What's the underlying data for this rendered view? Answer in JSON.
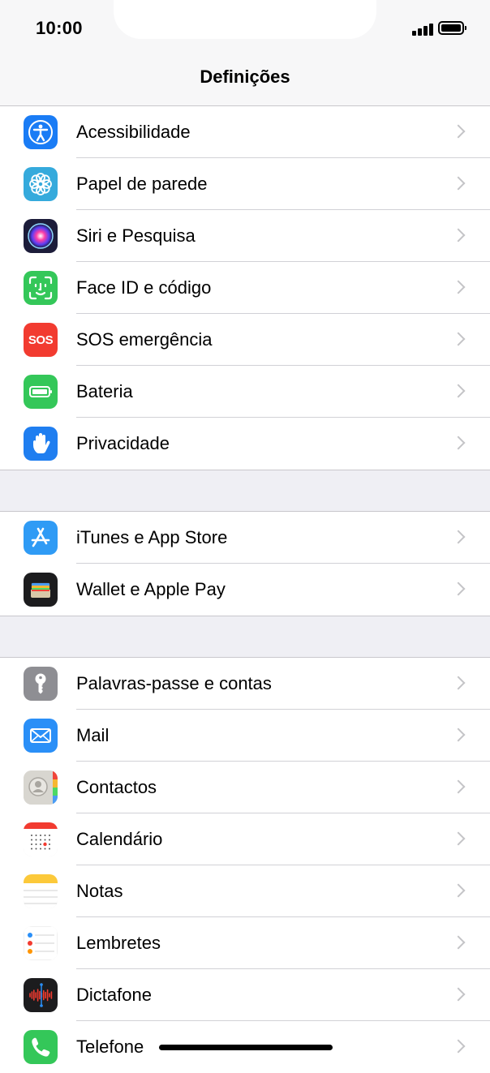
{
  "status": {
    "time": "10:00"
  },
  "nav": {
    "title": "Definições"
  },
  "groups": [
    [
      {
        "label": "Acessibilidade",
        "icon": "accessibility-icon",
        "color": "#1a7cf5"
      },
      {
        "label": "Papel de parede",
        "icon": "wallpaper-icon",
        "color": "#35aadc"
      },
      {
        "label": "Siri e Pesquisa",
        "icon": "siri-icon",
        "color": "#1c1c3a"
      },
      {
        "label": "Face ID e código",
        "icon": "face-id-icon",
        "color": "#34c759"
      },
      {
        "label": "SOS emergência",
        "icon": "sos-icon",
        "color": "#f23b30",
        "icon_text": "SOS"
      },
      {
        "label": "Bateria",
        "icon": "battery-icon",
        "color": "#34c759"
      },
      {
        "label": "Privacidade",
        "icon": "hand-icon",
        "color": "#1f7ef0"
      }
    ],
    [
      {
        "label": "iTunes e App Store",
        "icon": "app-store-icon",
        "color": "#2f9bf5"
      },
      {
        "label": "Wallet e Apple Pay",
        "icon": "wallet-icon",
        "color": "#1c1c1e"
      }
    ],
    [
      {
        "label": "Palavras-passe e contas",
        "icon": "key-icon",
        "color": "#8e8e93"
      },
      {
        "label": "Mail",
        "icon": "mail-icon",
        "color": "#2a8ff7"
      },
      {
        "label": "Contactos",
        "icon": "contacts-icon",
        "color": "#d8d6d0"
      },
      {
        "label": "Calendário",
        "icon": "calendar-icon",
        "color": "#ffffff"
      },
      {
        "label": "Notas",
        "icon": "notes-icon",
        "color": "#ffffff"
      },
      {
        "label": "Lembretes",
        "icon": "reminders-icon",
        "color": "#ffffff"
      },
      {
        "label": "Dictafone",
        "icon": "voice-memos-icon",
        "color": "#1c1c1e"
      },
      {
        "label": "Telefone",
        "icon": "phone-icon",
        "color": "#34c759"
      }
    ]
  ]
}
